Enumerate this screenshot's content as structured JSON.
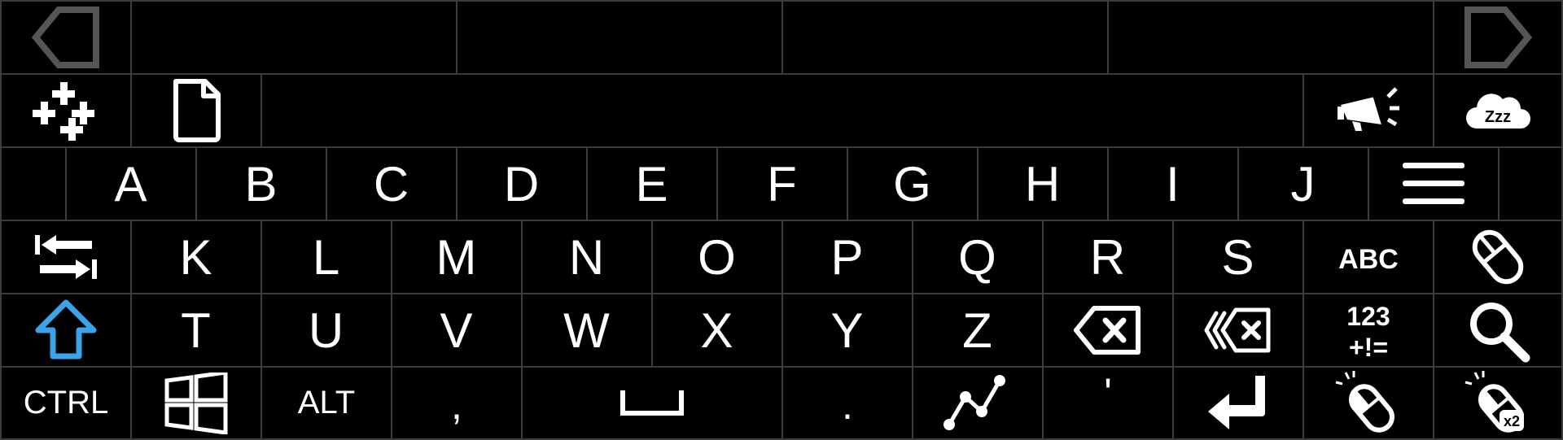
{
  "row_suggestions": {
    "keys": []
  },
  "row_tools": {
    "keys": []
  },
  "row1": {
    "keys": [
      "A",
      "B",
      "C",
      "D",
      "E",
      "F",
      "G",
      "H",
      "I",
      "J"
    ]
  },
  "row2": {
    "keys": [
      "K",
      "L",
      "M",
      "N",
      "O",
      "P",
      "Q",
      "R",
      "S"
    ]
  },
  "row3": {
    "keys": [
      "T",
      "U",
      "V",
      "W",
      "X",
      "Y",
      "Z"
    ]
  },
  "row4": {
    "ctrl": "CTRL",
    "alt": "ALT",
    "comma": ",",
    "period": ".",
    "apostrophe": "'"
  },
  "icon_text": {
    "sleep": "Zzz",
    "abc": "ABC",
    "numbers_top": "123",
    "numbers_bottom": "+!=",
    "double_click": "x2"
  },
  "colors": {
    "background": "#000000",
    "key_border": "#3c3c3c",
    "icon": "#ffffff",
    "nav_arrow": "#555555",
    "shift_active": "#3ba3e8"
  }
}
